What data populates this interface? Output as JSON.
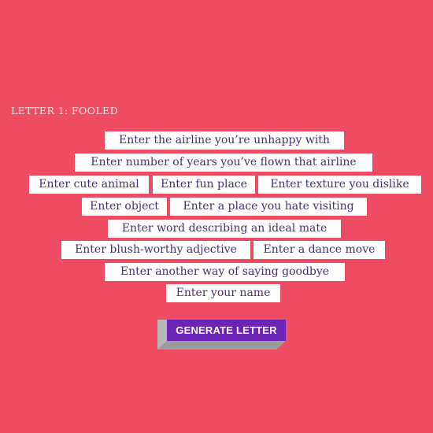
{
  "letter": {
    "title": "LETTER 1: FOOLED"
  },
  "fields": {
    "airline": "Enter the airline you’re unhappy with",
    "years_flown": "Enter number of years you’ve flown that airline",
    "cute_animal": "Enter cute animal",
    "fun_place": "Enter fun place",
    "texture_dislike": "Enter texture you dislike",
    "object": "Enter object",
    "place_hate": "Enter a place you hate visiting",
    "ideal_mate_word": "Enter word describing an ideal mate",
    "blush_adjective": "Enter blush-worthy adjective",
    "dance_move": "Enter a dance move",
    "goodbye": "Enter another way of saying goodbye",
    "your_name": "Enter your name"
  },
  "button": {
    "label": "GENERATE LETTER"
  },
  "colors": {
    "background": "#ee4c62",
    "field_text": "#4a2f73",
    "button_face": "#6d23b7",
    "button_shadow": "#9a9a9a"
  }
}
